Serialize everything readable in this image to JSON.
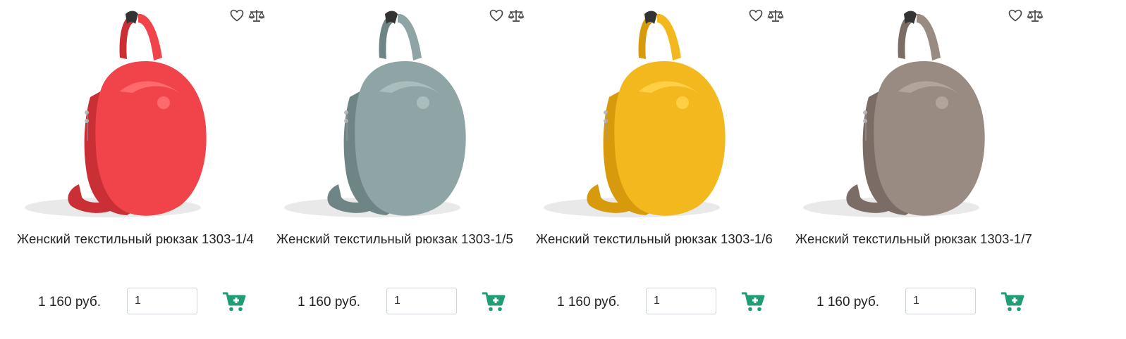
{
  "colors": {
    "accent_green": "#1f9d74",
    "icon_gray": "#444444",
    "text": "#222222"
  },
  "icons": {
    "favorite": "heart-icon",
    "compare": "scales-icon",
    "cart": "add-to-cart-icon"
  },
  "products": [
    {
      "title": "Женский текстильный рюкзак 1303-1/4",
      "price": "1 160 руб.",
      "quantity": "1",
      "bag_color": "#f0444a",
      "bag_shade": "#c92f35",
      "bag_light": "#ff6a6d"
    },
    {
      "title": "Женский текстильный рюкзак 1303-1/5",
      "price": "1 160 руб.",
      "quantity": "1",
      "bag_color": "#8fa5a5",
      "bag_shade": "#6f8585",
      "bag_light": "#a9bdbd"
    },
    {
      "title": "Женский текстильный рюкзак 1303-1/6",
      "price": "1 160 руб.",
      "quantity": "1",
      "bag_color": "#f2b81e",
      "bag_shade": "#d69a0c",
      "bag_light": "#ffcf45"
    },
    {
      "title": "Женский текстильный рюкзак 1303-1/7",
      "price": "1 160 руб.",
      "quantity": "1",
      "bag_color": "#9a8b82",
      "bag_shade": "#7b6d65",
      "bag_light": "#b2a49b"
    }
  ]
}
